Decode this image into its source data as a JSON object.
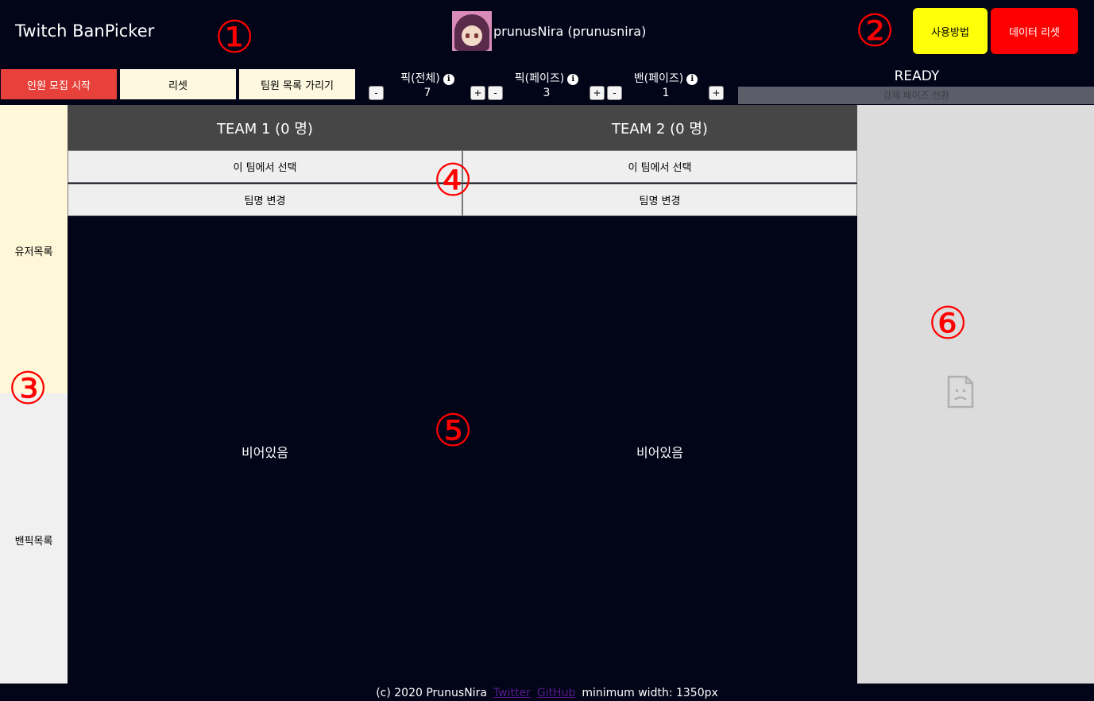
{
  "header": {
    "title": "Twitch BanPicker",
    "user_name": "prunusNira (prunusnira)",
    "howto_label": "사용방법",
    "reset_data_label": "데이터 리셋"
  },
  "controls": {
    "recruit_label": "인원 모집 시작",
    "reset_label": "리셋",
    "hide_members_label": "팀원 목록 가리기",
    "pick_total": {
      "label": "픽(전체)",
      "value": "7"
    },
    "pick_phase": {
      "label": "픽(페이즈)",
      "value": "3"
    },
    "ban_phase": {
      "label": "밴(페이즈)",
      "value": "1"
    },
    "minus": "-",
    "plus": "+",
    "info_glyph": "i",
    "status": "READY",
    "force_phase_label": "강제 페이즈 전환"
  },
  "sidebar": {
    "user_list_label": "유저목록",
    "banpick_list_label": "밴픽목록"
  },
  "teams": [
    {
      "header": "TEAM 1 (0 명)",
      "select_label": "이 팀에서 선택",
      "rename_label": "팀명 변경",
      "empty_label": "비어있음"
    },
    {
      "header": "TEAM 2 (0 명)",
      "select_label": "이 팀에서 선택",
      "rename_label": "팀명 변경",
      "empty_label": "비어있음"
    }
  ],
  "footer": {
    "copyright": "(c) 2020 PrunusNira",
    "twitter_label": "Twitter",
    "github_label": "GitHub",
    "min_width": "minimum width: 1350px"
  },
  "annotations": [
    "①",
    "②",
    "③",
    "④",
    "⑤",
    "⑥"
  ],
  "colors": {
    "background": "#020418",
    "howto_button": "#ffff0a",
    "reset_data_button": "#ff0000",
    "recruit_button": "#e8413b",
    "annotation": "#ff0000"
  },
  "icons": [
    "info-icon",
    "broken-image-icon",
    "avatar"
  ]
}
